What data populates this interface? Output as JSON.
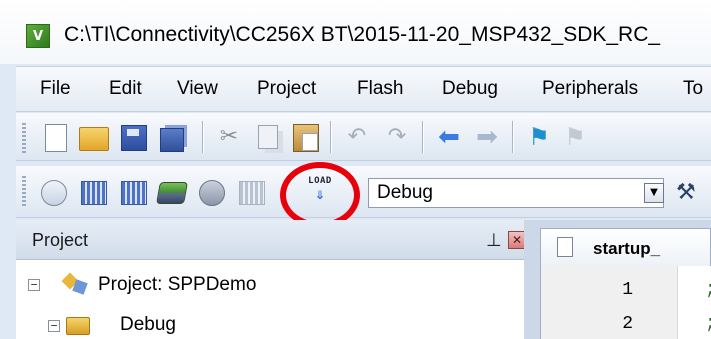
{
  "window": {
    "app_logo": "V",
    "title": "C:\\TI\\Connectivity\\CC256X BT\\2015-11-20_MSP432_SDK_RC_"
  },
  "menubar": {
    "items": [
      "File",
      "Edit",
      "View",
      "Project",
      "Flash",
      "Debug",
      "Peripherals",
      "To"
    ]
  },
  "toolbar_build": {
    "load_label": "LOAD",
    "config_selected": "Debug"
  },
  "project_pane": {
    "title": "Project",
    "tree": [
      {
        "label": "Project: SPPDemo",
        "expander": "−"
      },
      {
        "label": "Debug",
        "expander": "−"
      }
    ]
  },
  "editor": {
    "tab_label": "startup_",
    "lines": [
      "1",
      "2"
    ],
    "line_text": [
      ";",
      ";"
    ]
  },
  "colors": {
    "highlight_circle": "#e8000b",
    "accent": "#2b6fe0"
  }
}
